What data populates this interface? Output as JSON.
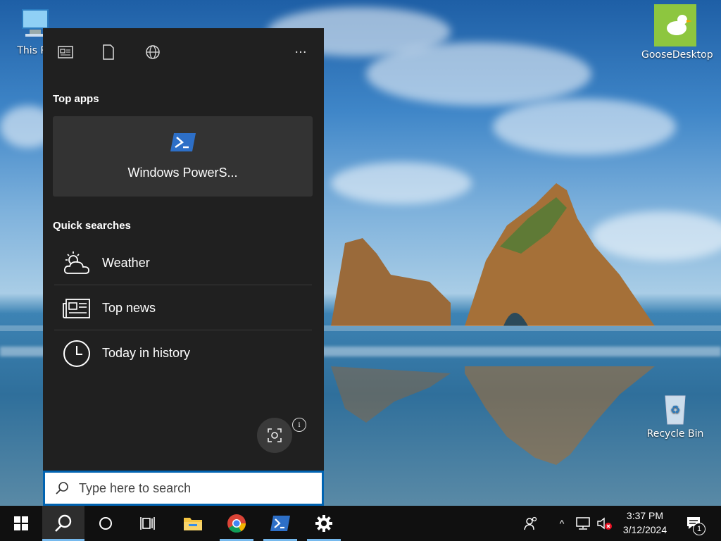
{
  "desktop": {
    "icons": [
      {
        "label": "This PC",
        "icon": "computer-icon"
      },
      {
        "label": "GooseDesktop",
        "icon": "goose-icon"
      },
      {
        "label": "Recycle Bin",
        "icon": "recycle-bin-icon"
      }
    ]
  },
  "search_panel": {
    "header_icons": [
      "news-icon",
      "document-icon",
      "web-icon",
      "more-icon"
    ],
    "more_label": "···",
    "top_apps_title": "Top apps",
    "top_app": {
      "label": "Windows PowerS...",
      "icon": "powershell-icon"
    },
    "quick_searches_title": "Quick searches",
    "quick_searches": [
      {
        "label": "Weather",
        "icon": "weather-icon"
      },
      {
        "label": "Top news",
        "icon": "newspaper-icon"
      },
      {
        "label": "Today in history",
        "icon": "clock-icon"
      }
    ],
    "info_label": "i"
  },
  "search": {
    "placeholder": "Type here to search",
    "value": ""
  },
  "taskbar": {
    "apps": [
      "start-icon",
      "search-icon",
      "cortana-icon",
      "task-view-icon",
      "file-explorer-icon",
      "chrome-icon",
      "powershell-icon",
      "settings-icon"
    ],
    "tray": {
      "people": "people-icon",
      "chevron": "^",
      "network": "network-icon",
      "volume": "volume-muted-icon",
      "time": "3:37 PM",
      "date": "3/12/2024",
      "notification_count": "1"
    }
  },
  "colors": {
    "panel_bg": "#202020",
    "tile_bg": "#333333",
    "accent": "#0063b1",
    "taskbar_bg": "#101010",
    "active_underline": "#76b9ed"
  }
}
